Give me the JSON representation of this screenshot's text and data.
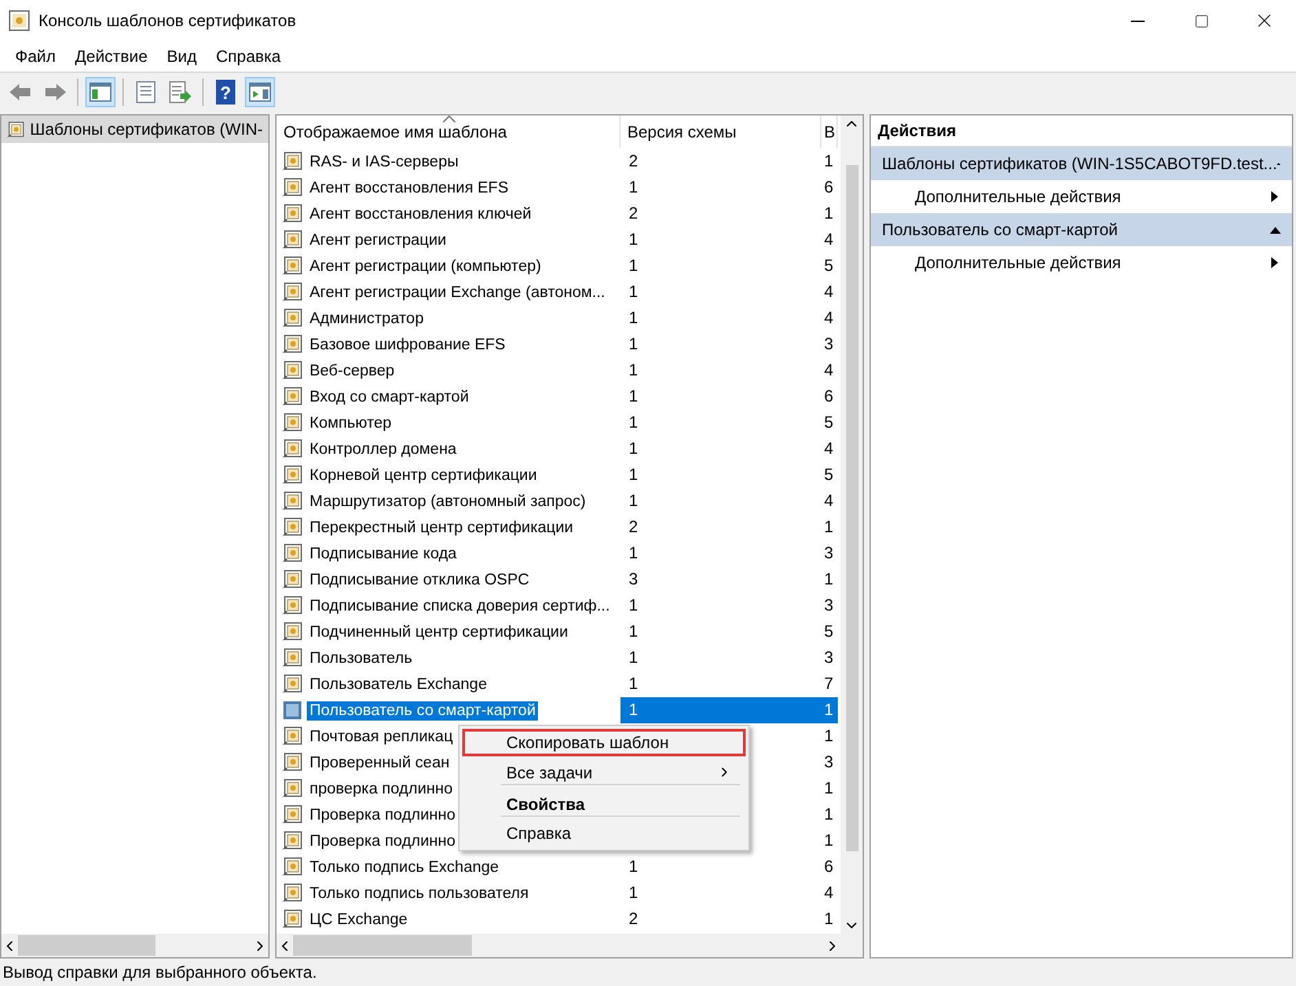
{
  "window": {
    "title": "Консоль шаблонов сертификатов"
  },
  "menu": [
    "Файл",
    "Действие",
    "Вид",
    "Справка"
  ],
  "toolbar": [
    {
      "kind": "back",
      "active": false
    },
    {
      "kind": "forward",
      "active": false
    },
    {
      "kind": "sep"
    },
    {
      "kind": "tree",
      "active": true
    },
    {
      "kind": "sep"
    },
    {
      "kind": "properties",
      "active": false
    },
    {
      "kind": "export",
      "active": false
    },
    {
      "kind": "sep"
    },
    {
      "kind": "help",
      "active": false,
      "glyph": "?"
    },
    {
      "kind": "pane",
      "active": true
    }
  ],
  "tree": [
    {
      "label": "Шаблоны сертификатов (WIN-",
      "selected": true
    }
  ],
  "table": {
    "columns": [
      {
        "label": "Отображаемое имя шаблона",
        "sorted": true
      },
      {
        "label": "Версия схемы",
        "sorted": false
      },
      {
        "label": "В",
        "sorted": false
      }
    ],
    "rows": [
      {
        "name": "RAS- и IAS-серверы",
        "version": "2",
        "column_3": "1",
        "selected": false
      },
      {
        "name": "Агент восстановления EFS",
        "version": "1",
        "column_3": "6",
        "selected": false
      },
      {
        "name": "Агент восстановления ключей",
        "version": "2",
        "column_3": "1",
        "selected": false
      },
      {
        "name": "Агент регистрации",
        "version": "1",
        "column_3": "4",
        "selected": false
      },
      {
        "name": "Агент регистрации (компьютер)",
        "version": "1",
        "column_3": "5",
        "selected": false
      },
      {
        "name": "Агент регистрации Exchange (автоном...",
        "version": "1",
        "column_3": "4",
        "selected": false
      },
      {
        "name": "Администратор",
        "version": "1",
        "column_3": "4",
        "selected": false
      },
      {
        "name": "Базовое шифрование EFS",
        "version": "1",
        "column_3": "3",
        "selected": false
      },
      {
        "name": "Веб-сервер",
        "version": "1",
        "column_3": "4",
        "selected": false
      },
      {
        "name": "Вход со смарт-картой",
        "version": "1",
        "column_3": "6",
        "selected": false
      },
      {
        "name": "Компьютер",
        "version": "1",
        "column_3": "5",
        "selected": false
      },
      {
        "name": "Контроллер домена",
        "version": "1",
        "column_3": "4",
        "selected": false
      },
      {
        "name": "Корневой центр сертификации",
        "version": "1",
        "column_3": "5",
        "selected": false
      },
      {
        "name": "Маршрутизатор (автономный запрос)",
        "version": "1",
        "column_3": "4",
        "selected": false
      },
      {
        "name": "Перекрестный центр сертификации",
        "version": "2",
        "column_3": "1",
        "selected": false
      },
      {
        "name": "Подписывание кода",
        "version": "1",
        "column_3": "3",
        "selected": false
      },
      {
        "name": "Подписывание отклика OSPC",
        "version": "3",
        "column_3": "1",
        "selected": false
      },
      {
        "name": "Подписывание списка доверия сертиф...",
        "version": "1",
        "column_3": "3",
        "selected": false
      },
      {
        "name": "Подчиненный центр сертификации",
        "version": "1",
        "column_3": "5",
        "selected": false
      },
      {
        "name": "Пользователь",
        "version": "1",
        "column_3": "3",
        "selected": false
      },
      {
        "name": "Пользователь Exchange",
        "version": "1",
        "column_3": "7",
        "selected": false
      },
      {
        "name": "Пользователь со смарт-картой",
        "version": "1",
        "column_3": "1",
        "selected": true
      },
      {
        "name": "Почтовая репликац",
        "column_3": "1",
        "selected": false
      },
      {
        "name": "Проверенный сеан",
        "column_3": "3",
        "selected": false
      },
      {
        "name": "проверка подлинно",
        "column_3": "1",
        "selected": false
      },
      {
        "name": "Проверка подлинно",
        "column_3": "1",
        "selected": false
      },
      {
        "name": "Проверка подлинно",
        "column_3": "1",
        "selected": false
      },
      {
        "name": "Только подпись Exchange",
        "version": "1",
        "column_3": "6",
        "selected": false
      },
      {
        "name": "Только подпись пользователя",
        "version": "1",
        "column_3": "4",
        "selected": false
      },
      {
        "name": "ЦС Exchange",
        "version": "2",
        "column_3": "1",
        "selected": false
      }
    ]
  },
  "context_menu": [
    {
      "label": "Скопировать шаблон",
      "bold": false,
      "submenu": false,
      "highlighted": true
    },
    {
      "label": "Все задачи",
      "bold": false,
      "submenu": true,
      "highlighted": false,
      "separator_after": true
    },
    {
      "label": "Свойства",
      "bold": true,
      "submenu": false,
      "highlighted": false,
      "separator_after": true
    },
    {
      "label": "Справка",
      "bold": false,
      "submenu": false,
      "highlighted": false
    }
  ],
  "actions": {
    "title": "Действия",
    "sections": [
      {
        "title": "Шаблоны сертификатов (WIN-1S5CABOT9FD.test...",
        "expanded": true,
        "items": [
          "Дополнительные действия"
        ]
      },
      {
        "title": "Пользователь со смарт-картой",
        "expanded": true,
        "items": [
          "Дополнительные действия"
        ]
      }
    ]
  },
  "status_bar": "Вывод справки для выбранного объекта."
}
